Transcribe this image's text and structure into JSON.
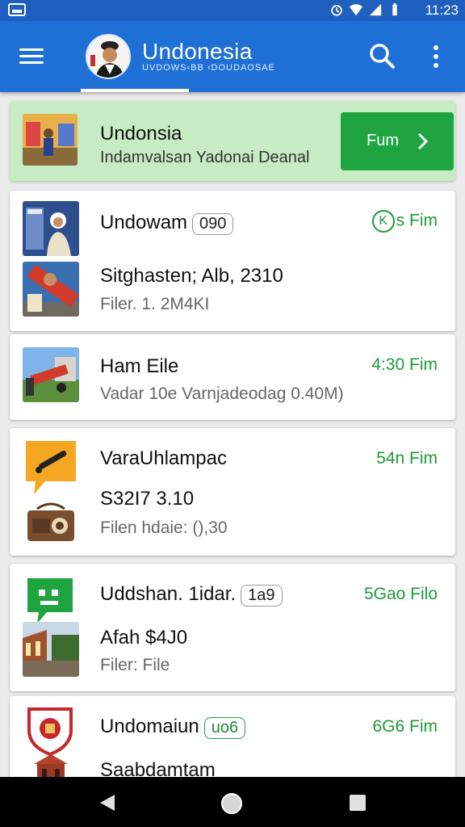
{
  "status_bar": {
    "time": "11:23",
    "icons": [
      "gallery-icon",
      "alarm-icon",
      "wifi-icon",
      "signal-icon",
      "battery-icon"
    ]
  },
  "app_bar": {
    "title": "Undonesia",
    "subtitle": "UVDOWS‹BB ‹DOUDAOSAE",
    "icons": [
      "menu-icon",
      "search-icon",
      "more-vert-icon"
    ]
  },
  "featured": {
    "title": "Undonsia",
    "subtitle": "Indamvalsan Yadonai Deanal",
    "button_label": "Fum",
    "accent_color": "#1ea540",
    "background_color": "#c7ecc4"
  },
  "cards": [
    {
      "title": "Undowam",
      "badge": "090",
      "time_badge": "K",
      "time": "s Fim",
      "line2": "Sitghasten; Alb, 2310",
      "line3": "Filer. 1. 2M4KI"
    },
    {
      "title": "Ham Eile",
      "time": "4:30 Fim",
      "line3": "Vadar 10e Varnjadeodag 0.40M)"
    },
    {
      "title": "VaraUhlampac",
      "time": "54n Fim",
      "line2": "S32I7 3.10",
      "line3": "Filen hdaie: (),30"
    },
    {
      "title": "Uddshan. 1idar.",
      "badge": "1a9",
      "time": "5Gao Filo",
      "line2": "Afah $4J0",
      "line3": "Filer: File"
    },
    {
      "title": "Undomaiun",
      "badge": "uo6",
      "time": "6G6 Fim",
      "line2": "Saabdamtam"
    }
  ],
  "colors": {
    "primary": "#1e6fd6",
    "status_bar": "#1f5fbf",
    "time_green": "#1d9a39"
  },
  "nav_bar": {
    "icons": [
      "back-icon",
      "home-icon",
      "recents-icon"
    ]
  }
}
